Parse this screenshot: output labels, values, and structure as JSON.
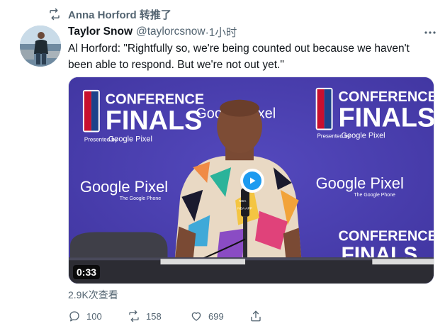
{
  "retweet": {
    "label": "Anna Horford 转推了",
    "icon": "retweet-icon"
  },
  "tweet": {
    "author_name": "Taylor Snow",
    "author_handle": "@taylorcsnow",
    "time": "·1小时",
    "text": "Al Horford: \"Rightfully so, we're being counted out because we haven't been able to respond. But we're not out yet.\"",
    "more_icon": "more-icon"
  },
  "media": {
    "duration": "0:33",
    "play_icon": "play-icon",
    "backdrop": {
      "conference": "CONFERENCE",
      "finals": "FINALS",
      "presented": "Presented by",
      "google_pixel": "Google Pixel",
      "the_google_phone": "The Google Phone",
      "nba": "NBA",
      "nba_app": "NBA APP"
    }
  },
  "views": "2.9K次查看",
  "actions": {
    "reply_count": "100",
    "retweet_count": "158",
    "like_count": "699"
  },
  "colors": {
    "accent": "#1d9bf0",
    "muted": "#536471",
    "backdrop": "#4d3fb2"
  }
}
